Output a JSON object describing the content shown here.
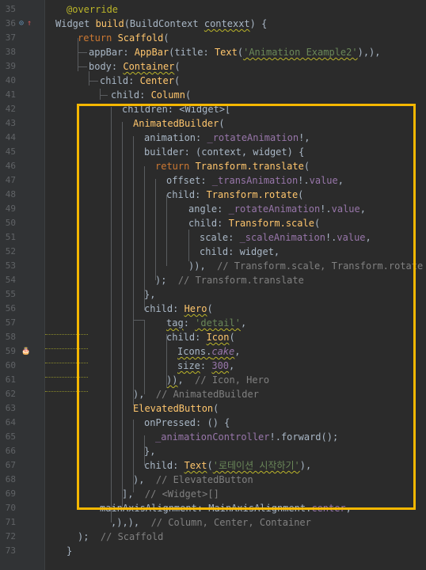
{
  "editor": {
    "lines": [
      {
        "n": "35",
        "gutter_icon": "",
        "parts": [
          [
            "ann",
            "@override"
          ]
        ]
      },
      {
        "n": "36",
        "gutter_icon": "override-breakpoint-icon",
        "parts": [
          [
            "",
            "Widget "
          ],
          [
            "cls",
            "build"
          ],
          [
            "",
            "(BuildContext "
          ],
          [
            "wavy",
            "contexxt"
          ],
          [
            "",
            ") {"
          ]
        ]
      },
      {
        "n": "37",
        "gutter_icon": "",
        "parts": [
          [
            "kw",
            "return "
          ],
          [
            "cls",
            "Scaffold"
          ],
          [
            "",
            "("
          ]
        ]
      },
      {
        "n": "38",
        "gutter_icon": "",
        "parts": [
          [
            "",
            "appBar: "
          ],
          [
            "cls",
            "AppBar"
          ],
          [
            "",
            "(title: "
          ],
          [
            "cls",
            "Text"
          ],
          [
            "",
            "("
          ],
          [
            "str wavy",
            "'Animation Example2'"
          ],
          [
            "",
            "),),"
          ]
        ]
      },
      {
        "n": "39",
        "gutter_icon": "",
        "parts": [
          [
            "",
            "body: "
          ],
          [
            "cls wavy",
            "Container"
          ],
          [
            "",
            "("
          ]
        ]
      },
      {
        "n": "40",
        "gutter_icon": "",
        "parts": [
          [
            "",
            "child: "
          ],
          [
            "cls",
            "Center"
          ],
          [
            "",
            "("
          ]
        ]
      },
      {
        "n": "41",
        "gutter_icon": "",
        "parts": [
          [
            "",
            "child: "
          ],
          [
            "cls",
            "Column"
          ],
          [
            "",
            "("
          ]
        ]
      },
      {
        "n": "42",
        "gutter_icon": "",
        "parts": [
          [
            "",
            "children: <Widget>["
          ]
        ]
      },
      {
        "n": "43",
        "gutter_icon": "",
        "parts": [
          [
            "cls",
            "AnimatedBuilder"
          ],
          [
            "",
            "("
          ]
        ]
      },
      {
        "n": "44",
        "gutter_icon": "",
        "parts": [
          [
            "",
            "animation: "
          ],
          [
            "fld",
            "_rotateAnimation"
          ],
          [
            "",
            "!,"
          ]
        ]
      },
      {
        "n": "45",
        "gutter_icon": "",
        "parts": [
          [
            "",
            "builder: (context, widget) {"
          ]
        ]
      },
      {
        "n": "46",
        "gutter_icon": "",
        "parts": [
          [
            "kw",
            "return "
          ],
          [
            "cls",
            "Transform.translate"
          ],
          [
            "",
            "("
          ]
        ]
      },
      {
        "n": "47",
        "gutter_icon": "",
        "parts": [
          [
            "",
            "offset: "
          ],
          [
            "fld",
            "_transAnimation"
          ],
          [
            "",
            "!."
          ],
          [
            "fld",
            "value"
          ],
          [
            "",
            ","
          ]
        ]
      },
      {
        "n": "48",
        "gutter_icon": "",
        "parts": [
          [
            "",
            "child: "
          ],
          [
            "cls",
            "Transform.rotate"
          ],
          [
            "",
            "("
          ]
        ]
      },
      {
        "n": "49",
        "gutter_icon": "",
        "parts": [
          [
            "",
            "angle: "
          ],
          [
            "fld",
            "_rotateAnimation"
          ],
          [
            "",
            "!."
          ],
          [
            "fld",
            "value"
          ],
          [
            "",
            ","
          ]
        ]
      },
      {
        "n": "50",
        "gutter_icon": "",
        "parts": [
          [
            "",
            "child: "
          ],
          [
            "cls",
            "Transform.scale"
          ],
          [
            "",
            "("
          ]
        ]
      },
      {
        "n": "51",
        "gutter_icon": "",
        "parts": [
          [
            "",
            "scale: "
          ],
          [
            "fld",
            "_scaleAnimation"
          ],
          [
            "",
            "!."
          ],
          [
            "fld",
            "value"
          ],
          [
            "",
            ","
          ]
        ]
      },
      {
        "n": "52",
        "gutter_icon": "",
        "parts": [
          [
            "",
            "child: widget,"
          ]
        ]
      },
      {
        "n": "53",
        "gutter_icon": "",
        "parts": [
          [
            "",
            ")),  "
          ],
          [
            "cmt",
            "// Transform.scale, Transform.rotate"
          ]
        ]
      },
      {
        "n": "54",
        "gutter_icon": "",
        "parts": [
          [
            "",
            ");  "
          ],
          [
            "cmt",
            "// Transform.translate"
          ]
        ]
      },
      {
        "n": "55",
        "gutter_icon": "",
        "parts": [
          [
            "",
            "},"
          ]
        ]
      },
      {
        "n": "56",
        "gutter_icon": "",
        "parts": [
          [
            "",
            "child: "
          ],
          [
            "cls wavy",
            "Hero"
          ],
          [
            "",
            "("
          ]
        ]
      },
      {
        "n": "57",
        "gutter_icon": "",
        "parts": [
          [
            "wavy",
            "tag"
          ],
          [
            "",
            ": "
          ],
          [
            "str wavy",
            "'detail'"
          ],
          [
            "",
            ","
          ]
        ]
      },
      {
        "n": "58",
        "gutter_icon": "",
        "parts": [
          [
            "",
            "child: "
          ],
          [
            "cls wavy",
            "Icon"
          ],
          [
            "",
            "("
          ]
        ]
      },
      {
        "n": "59",
        "gutter_icon": "cake-icon",
        "parts": [
          [
            "wavy",
            "Icons."
          ],
          [
            "fld italic wavy",
            "cake"
          ],
          [
            "",
            ","
          ]
        ]
      },
      {
        "n": "60",
        "gutter_icon": "",
        "parts": [
          [
            "wavy",
            "size"
          ],
          [
            "",
            ": "
          ],
          [
            "fld wavy",
            "300"
          ],
          [
            "",
            ","
          ]
        ]
      },
      {
        "n": "61",
        "gutter_icon": "",
        "parts": [
          [
            "wavy",
            "))"
          ],
          [
            "",
            ",  "
          ],
          [
            "cmt",
            "// Icon, Hero"
          ]
        ]
      },
      {
        "n": "62",
        "gutter_icon": "",
        "parts": [
          [
            "",
            "),  "
          ],
          [
            "cmt",
            "// AnimatedBuilder"
          ]
        ]
      },
      {
        "n": "63",
        "gutter_icon": "",
        "parts": [
          [
            "cls",
            "ElevatedButton"
          ],
          [
            "",
            "("
          ]
        ]
      },
      {
        "n": "64",
        "gutter_icon": "",
        "parts": [
          [
            "",
            "onPressed: () {"
          ]
        ]
      },
      {
        "n": "65",
        "gutter_icon": "",
        "parts": [
          [
            "fld",
            "_animationController"
          ],
          [
            "",
            "!.forward();"
          ]
        ]
      },
      {
        "n": "66",
        "gutter_icon": "",
        "parts": [
          [
            "",
            "},"
          ]
        ]
      },
      {
        "n": "67",
        "gutter_icon": "",
        "parts": [
          [
            "",
            "child: "
          ],
          [
            "cls wavy",
            "Text"
          ],
          [
            "",
            "("
          ],
          [
            "str wavy",
            "'로테이션 시작하기'"
          ],
          [
            "",
            "),"
          ]
        ]
      },
      {
        "n": "68",
        "gutter_icon": "",
        "parts": [
          [
            "",
            "),  "
          ],
          [
            "cmt",
            "// ElevatedButton"
          ]
        ]
      },
      {
        "n": "69",
        "gutter_icon": "",
        "parts": [
          [
            "",
            "],  "
          ],
          [
            "cmt",
            "// <Widget>[]"
          ]
        ]
      },
      {
        "n": "70",
        "gutter_icon": "",
        "parts": [
          [
            "",
            "mainAxisAlignment: MainAxisAlignment."
          ],
          [
            "fld",
            "center"
          ],
          [
            "",
            ","
          ]
        ]
      },
      {
        "n": "71",
        "gutter_icon": "",
        "parts": [
          [
            "",
            ",),),  "
          ],
          [
            "cmt",
            "// Column, Center, Container"
          ]
        ]
      },
      {
        "n": "72",
        "gutter_icon": "",
        "parts": [
          [
            "",
            ");  "
          ],
          [
            "cmt",
            "// Scaffold"
          ]
        ]
      },
      {
        "n": "73",
        "gutter_icon": "",
        "parts": [
          [
            "",
            "}"
          ]
        ]
      }
    ]
  },
  "colors": {
    "background": "#2b2b2b",
    "gutter": "#313335",
    "highlight_box": "#f5b700"
  }
}
